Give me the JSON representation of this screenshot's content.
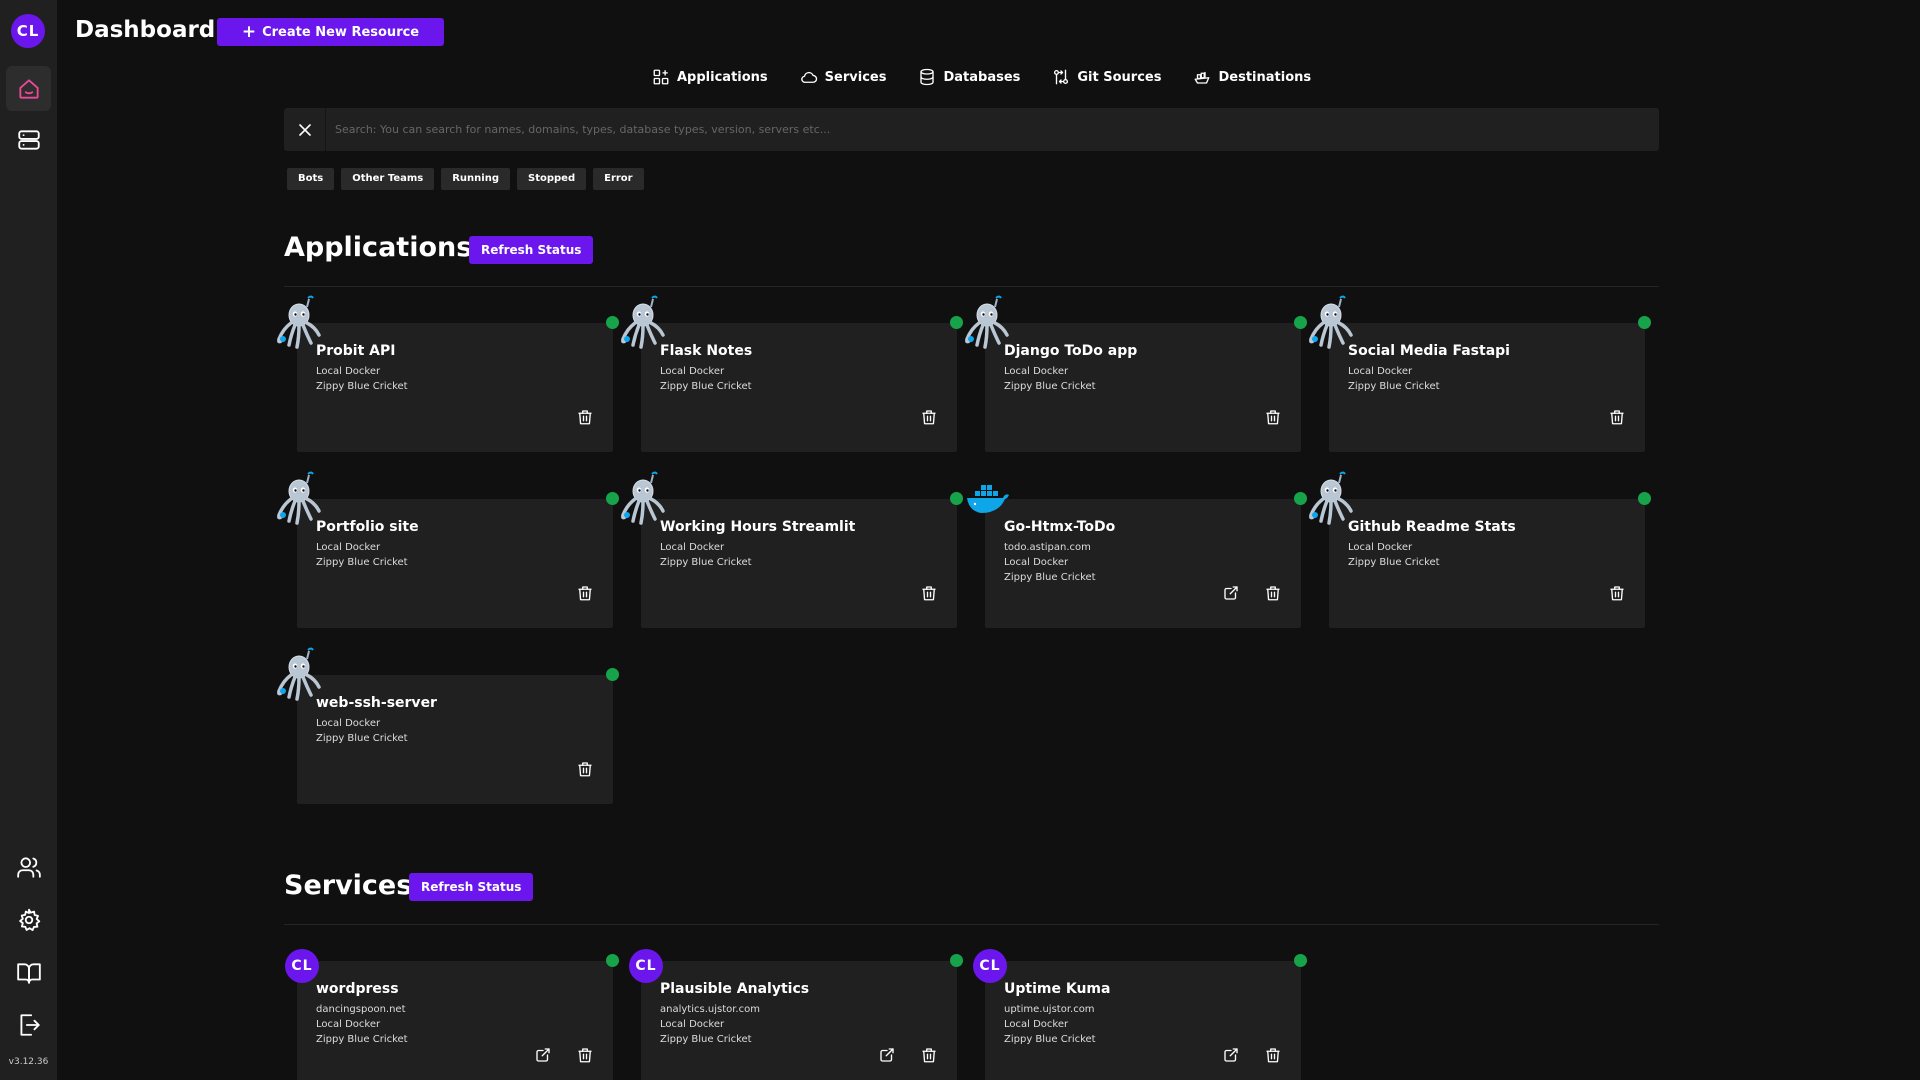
{
  "sidebar": {
    "avatar": "CL",
    "version": "v3.12.36",
    "icons": [
      "home-icon",
      "servers-icon",
      "users-icon",
      "settings-icon",
      "docs-icon",
      "logout-icon"
    ]
  },
  "header": {
    "title": "Dashboard",
    "create_label": "Create New Resource"
  },
  "nav": {
    "applications": "Applications",
    "services": "Services",
    "databases": "Databases",
    "git_sources": "Git Sources",
    "destinations": "Destinations"
  },
  "search": {
    "placeholder": "Search: You can search for names, domains, types, database types, version, servers etc...",
    "value": ""
  },
  "filters": [
    "Bots",
    "Other Teams",
    "Running",
    "Stopped",
    "Error"
  ],
  "colors": {
    "accent": "#6b16ed",
    "status_running": "#16a34a",
    "sidebar_bg": "#202020",
    "card_bg": "#202020"
  },
  "applications": {
    "title": "Applications",
    "refresh_label": "Refresh Status",
    "items": [
      {
        "name": "Probit API",
        "icon": "python-octopus-icon",
        "lines": [
          "Local Docker",
          "Zippy Blue Cricket"
        ],
        "open_link": false
      },
      {
        "name": "Flask Notes",
        "icon": "python-octopus-icon",
        "lines": [
          "Local Docker",
          "Zippy Blue Cricket"
        ],
        "open_link": false
      },
      {
        "name": "Django ToDo app",
        "icon": "python-octopus-icon",
        "lines": [
          "Local Docker",
          "Zippy Blue Cricket"
        ],
        "open_link": false
      },
      {
        "name": "Social Media Fastapi",
        "icon": "python-octopus-icon",
        "lines": [
          "Local Docker",
          "Zippy Blue Cricket"
        ],
        "open_link": false
      },
      {
        "name": "Portfolio site",
        "icon": "python-octopus-icon",
        "lines": [
          "Local Docker",
          "Zippy Blue Cricket"
        ],
        "open_link": false
      },
      {
        "name": "Working Hours Streamlit",
        "icon": "python-octopus-icon",
        "lines": [
          "Local Docker",
          "Zippy Blue Cricket"
        ],
        "open_link": false
      },
      {
        "name": "Go-Htmx-ToDo",
        "icon": "docker-whale-icon",
        "lines": [
          "todo.astipan.com",
          "Local Docker",
          "Zippy Blue Cricket"
        ],
        "open_link": true
      },
      {
        "name": "Github Readme Stats",
        "icon": "python-octopus-icon",
        "lines": [
          "Local Docker",
          "Zippy Blue Cricket"
        ],
        "open_link": false
      },
      {
        "name": "web-ssh-server",
        "icon": "python-octopus-icon",
        "lines": [
          "Local Docker",
          "Zippy Blue Cricket"
        ],
        "open_link": false
      }
    ]
  },
  "services": {
    "title": "Services",
    "refresh_label": "Refresh Status",
    "items": [
      {
        "name": "wordpress",
        "avatar": "CL",
        "lines": [
          "dancingspoon.net",
          "Local Docker",
          "Zippy Blue Cricket"
        ],
        "open_link": true
      },
      {
        "name": "Plausible Analytics",
        "avatar": "CL",
        "lines": [
          "analytics.ujstor.com",
          "Local Docker",
          "Zippy Blue Cricket"
        ],
        "open_link": true
      },
      {
        "name": "Uptime Kuma",
        "avatar": "CL",
        "lines": [
          "uptime.ujstor.com",
          "Local Docker",
          "Zippy Blue Cricket"
        ],
        "open_link": true
      }
    ]
  }
}
